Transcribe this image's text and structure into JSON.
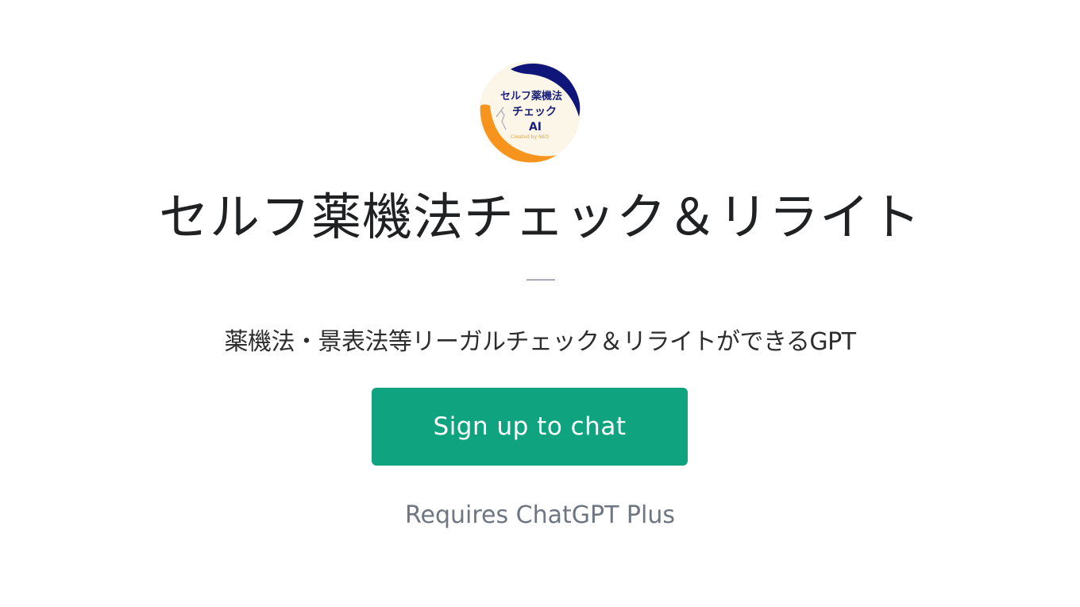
{
  "gpt": {
    "logo": {
      "alt": "セルフ薬機法チェックAI logo",
      "line1": "セルフ薬機法",
      "line2": "チェック",
      "line3": "AI",
      "credit": "Created by NEO",
      "colors": {
        "background": "#fbf6e8",
        "navy": "#10157a",
        "orange": "#f7941d"
      }
    },
    "title": "セルフ薬機法チェック＆リライト",
    "divider": "——",
    "description": "薬機法・景表法等リーガルチェック＆リライトができるGPT"
  },
  "actions": {
    "signup_label": "Sign up to chat",
    "signup_color": "#10a37f",
    "requirement_note": "Requires ChatGPT Plus"
  }
}
